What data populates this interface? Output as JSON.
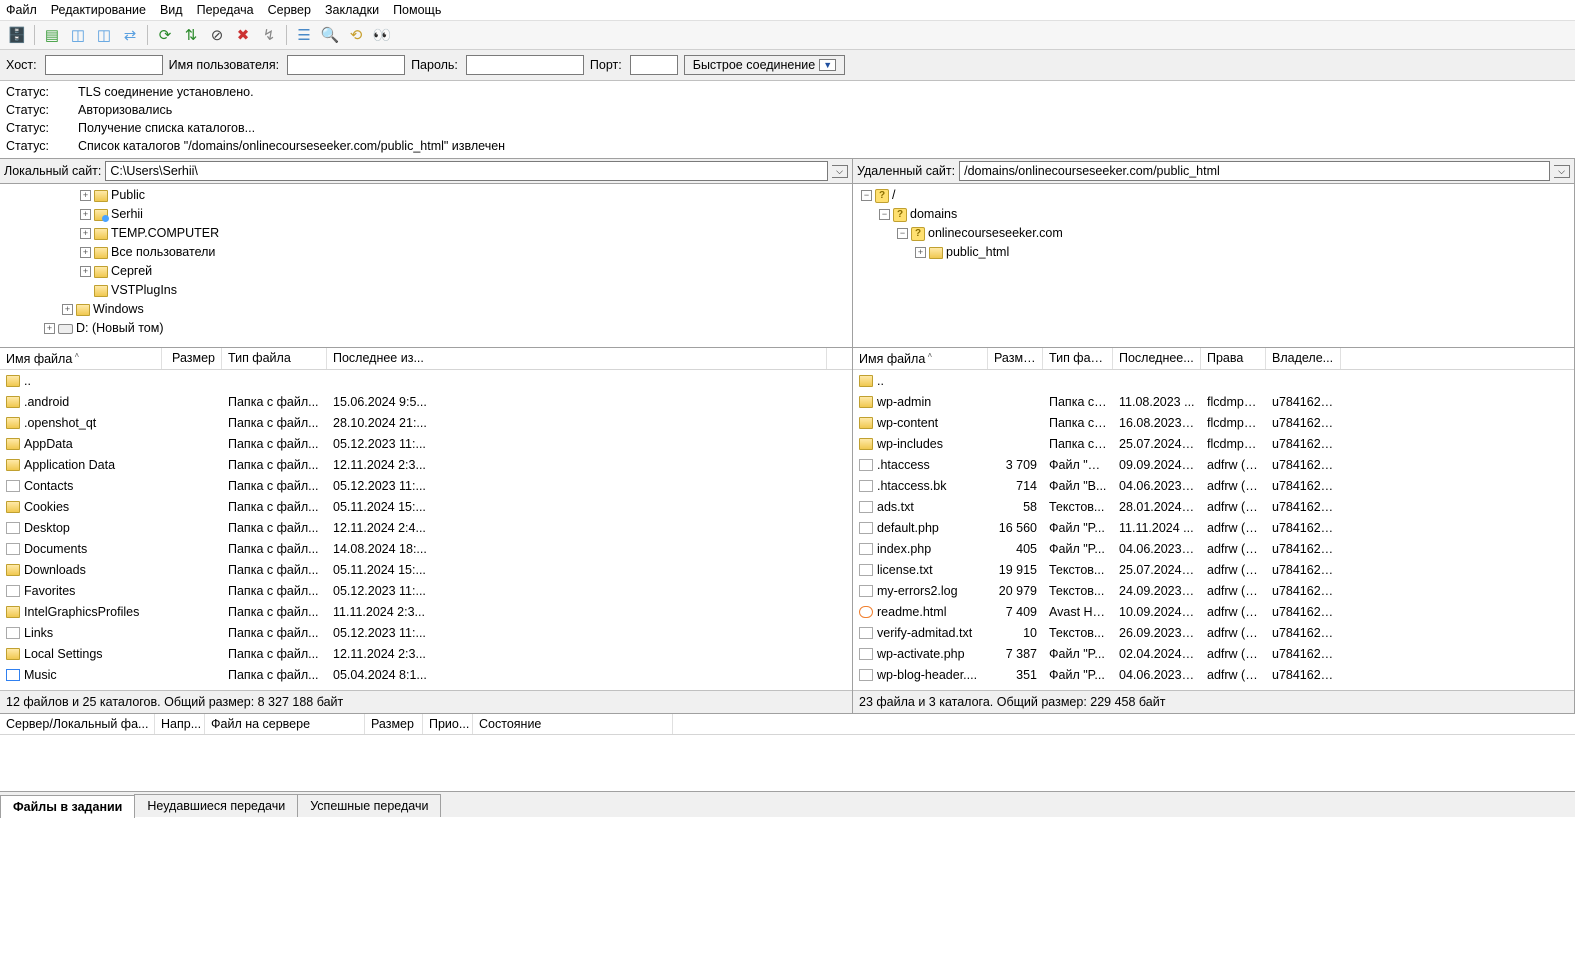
{
  "menu": [
    "Файл",
    "Редактирование",
    "Вид",
    "Передача",
    "Сервер",
    "Закладки",
    "Помощь"
  ],
  "qc": {
    "host_label": "Хост:",
    "user_label": "Имя пользователя:",
    "pass_label": "Пароль:",
    "port_label": "Порт:",
    "btn": "Быстрое соединение"
  },
  "log": [
    {
      "label": "Статус:",
      "text": "TLS соединение установлено."
    },
    {
      "label": "Статус:",
      "text": "Авторизовались"
    },
    {
      "label": "Статус:",
      "text": "Получение списка каталогов..."
    },
    {
      "label": "Статус:",
      "text": "Список каталогов \"/domains/onlinecourseseeker.com/public_html\" извлечен"
    }
  ],
  "local": {
    "site_label": "Локальный сайт:",
    "path": "C:\\Users\\Serhii\\",
    "tree": [
      {
        "indent": 4,
        "tw": "+",
        "icon": "fld",
        "text": "Public"
      },
      {
        "indent": 4,
        "tw": "+",
        "icon": "flds",
        "text": "Serhii"
      },
      {
        "indent": 4,
        "tw": "+",
        "icon": "fld",
        "text": "TEMP.COMPUTER"
      },
      {
        "indent": 4,
        "tw": "+",
        "icon": "fld",
        "text": "Все пользователи"
      },
      {
        "indent": 4,
        "tw": "+",
        "icon": "fld",
        "text": "Сергей"
      },
      {
        "indent": 4,
        "tw": "",
        "icon": "fld",
        "text": "VSTPlugIns"
      },
      {
        "indent": 3,
        "tw": "+",
        "icon": "fld",
        "text": "Windows"
      },
      {
        "indent": 2,
        "tw": "+",
        "icon": "drv",
        "text": "D: (Новый том)"
      }
    ],
    "cols": {
      "name": "Имя файла",
      "size": "Размер",
      "type": "Тип файла",
      "date": "Последнее из..."
    },
    "rows": [
      {
        "icon": "folder",
        "name": "..",
        "size": "",
        "type": "",
        "date": ""
      },
      {
        "icon": "folder",
        "name": ".android",
        "size": "",
        "type": "Папка с файл...",
        "date": "15.06.2024 9:5..."
      },
      {
        "icon": "folder",
        "name": ".openshot_qt",
        "size": "",
        "type": "Папка с файл...",
        "date": "28.10.2024 21:..."
      },
      {
        "icon": "folder",
        "name": "AppData",
        "size": "",
        "type": "Папка с файл...",
        "date": "05.12.2023 11:..."
      },
      {
        "icon": "folder",
        "name": "Application Data",
        "size": "",
        "type": "Папка с файл...",
        "date": "12.11.2024 2:3..."
      },
      {
        "icon": "sys",
        "name": "Contacts",
        "size": "",
        "type": "Папка с файл...",
        "date": "05.12.2023 11:..."
      },
      {
        "icon": "folder",
        "name": "Cookies",
        "size": "",
        "type": "Папка с файл...",
        "date": "05.11.2024 15:..."
      },
      {
        "icon": "sys",
        "name": "Desktop",
        "size": "",
        "type": "Папка с файл...",
        "date": "12.11.2024 2:4..."
      },
      {
        "icon": "sys",
        "name": "Documents",
        "size": "",
        "type": "Папка с файл...",
        "date": "14.08.2024 18:..."
      },
      {
        "icon": "folder",
        "name": "Downloads",
        "size": "",
        "type": "Папка с файл...",
        "date": "05.11.2024 15:..."
      },
      {
        "icon": "sys",
        "name": "Favorites",
        "size": "",
        "type": "Папка с файл...",
        "date": "05.12.2023 11:..."
      },
      {
        "icon": "folder",
        "name": "IntelGraphicsProfiles",
        "size": "",
        "type": "Папка с файл...",
        "date": "11.11.2024 2:3..."
      },
      {
        "icon": "sys",
        "name": "Links",
        "size": "",
        "type": "Папка с файл...",
        "date": "05.12.2023 11:..."
      },
      {
        "icon": "folder",
        "name": "Local Settings",
        "size": "",
        "type": "Папка с файл...",
        "date": "12.11.2024 2:3..."
      },
      {
        "icon": "music",
        "name": "Music",
        "size": "",
        "type": "Папка с файл...",
        "date": "05.04.2024 8:1..."
      }
    ],
    "summary": "12 файлов и 25 каталогов. Общий размер: 8 327 188 байт"
  },
  "remote": {
    "site_label": "Удаленный сайт:",
    "path": "/domains/onlinecourseseeker.com/public_html",
    "tree": [
      {
        "indent": 0,
        "tw": "−",
        "icon": "qmark",
        "text": "/"
      },
      {
        "indent": 1,
        "tw": "−",
        "icon": "qmark",
        "text": "domains"
      },
      {
        "indent": 2,
        "tw": "−",
        "icon": "qmark",
        "text": "onlinecourseseeker.com"
      },
      {
        "indent": 3,
        "tw": "+",
        "icon": "fld",
        "text": "public_html"
      }
    ],
    "cols": {
      "name": "Имя файла",
      "size": "Размер",
      "type": "Тип фай...",
      "date": "Последнее...",
      "perm": "Права",
      "own": "Владеле..."
    },
    "rows": [
      {
        "icon": "folder",
        "name": "..",
        "size": "",
        "type": "",
        "date": "",
        "perm": "",
        "own": ""
      },
      {
        "icon": "folder",
        "name": "wp-admin",
        "size": "",
        "type": "Папка с ...",
        "date": "11.08.2023 ...",
        "perm": "flcdmpe ...",
        "own": "u7841627..."
      },
      {
        "icon": "folder",
        "name": "wp-content",
        "size": "",
        "type": "Папка с ...",
        "date": "16.08.2023 ...",
        "perm": "flcdmpe ...",
        "own": "u7841627..."
      },
      {
        "icon": "folder",
        "name": "wp-includes",
        "size": "",
        "type": "Папка с ...",
        "date": "25.07.2024 ...",
        "perm": "flcdmpe ...",
        "own": "u7841627..."
      },
      {
        "icon": "file",
        "name": ".htaccess",
        "size": "3 709",
        "type": "Файл \"H...",
        "date": "09.09.2024 ...",
        "perm": "adfrw (0...",
        "own": "u7841627..."
      },
      {
        "icon": "file",
        "name": ".htaccess.bk",
        "size": "714",
        "type": "Файл \"B...",
        "date": "04.06.2023 ...",
        "perm": "adfrw (0...",
        "own": "u7841627..."
      },
      {
        "icon": "file",
        "name": "ads.txt",
        "size": "58",
        "type": "Текстов...",
        "date": "28.01.2024 ...",
        "perm": "adfrw (0...",
        "own": "u7841627..."
      },
      {
        "icon": "file",
        "name": "default.php",
        "size": "16 560",
        "type": "Файл \"P...",
        "date": "11.11.2024 ...",
        "perm": "adfrw (0...",
        "own": "u7841627..."
      },
      {
        "icon": "file",
        "name": "index.php",
        "size": "405",
        "type": "Файл \"P...",
        "date": "04.06.2023 ...",
        "perm": "adfrw (0...",
        "own": "u7841627..."
      },
      {
        "icon": "file",
        "name": "license.txt",
        "size": "19 915",
        "type": "Текстов...",
        "date": "25.07.2024 ...",
        "perm": "adfrw (0...",
        "own": "u7841627..."
      },
      {
        "icon": "file",
        "name": "my-errors2.log",
        "size": "20 979",
        "type": "Текстов...",
        "date": "24.09.2023 ...",
        "perm": "adfrw (0...",
        "own": "u7841627..."
      },
      {
        "icon": "html",
        "name": "readme.html",
        "size": "7 409",
        "type": "Avast HT...",
        "date": "10.09.2024 ...",
        "perm": "adfrw (0...",
        "own": "u7841627..."
      },
      {
        "icon": "file",
        "name": "verify-admitad.txt",
        "size": "10",
        "type": "Текстов...",
        "date": "26.09.2023 ...",
        "perm": "adfrw (0...",
        "own": "u7841627..."
      },
      {
        "icon": "file",
        "name": "wp-activate.php",
        "size": "7 387",
        "type": "Файл \"P...",
        "date": "02.04.2024 ...",
        "perm": "adfrw (0...",
        "own": "u7841627..."
      },
      {
        "icon": "file",
        "name": "wp-blog-header....",
        "size": "351",
        "type": "Файл \"P...",
        "date": "04.06.2023 ...",
        "perm": "adfrw (0...",
        "own": "u7841627..."
      }
    ],
    "summary": "23 файла и 3 каталога. Общий размер: 229 458 байт"
  },
  "queue": {
    "cols": [
      "Сервер/Локальный фа...",
      "Напр...",
      "Файл на сервере",
      "Размер",
      "Прио...",
      "Состояние"
    ]
  },
  "tabs": [
    "Файлы в задании",
    "Неудавшиеся передачи",
    "Успешные передачи"
  ]
}
